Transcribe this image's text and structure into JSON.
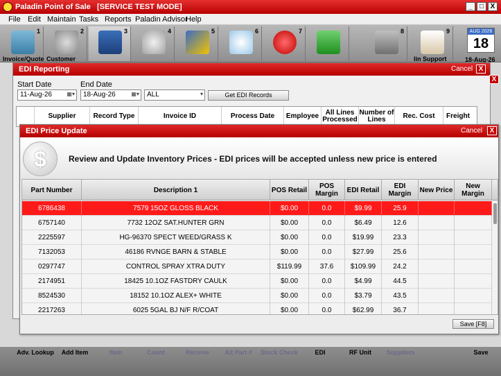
{
  "app": {
    "title": "Paladin Point of Sale",
    "mode": "[SERVICE TEST MODE]",
    "window_buttons": [
      "_",
      "□",
      "X"
    ]
  },
  "menu": [
    "File",
    "Edit",
    "Maintain",
    "Tasks",
    "Reports",
    "Paladin Advisor",
    "Help"
  ],
  "toolbar": {
    "buttons": [
      {
        "num": "1",
        "label": "Invoice/Quote",
        "icon": "calculator-icon"
      },
      {
        "num": "2",
        "label": "Customer",
        "icon": "customer-icon"
      },
      {
        "num": "3",
        "label": "",
        "icon": "inventory-book-icon"
      },
      {
        "num": "4",
        "label": "",
        "icon": "settings-icon"
      },
      {
        "num": "5",
        "label": "",
        "icon": "chart-icon"
      },
      {
        "num": "6",
        "label": "",
        "icon": "disc-icon"
      },
      {
        "num": "7",
        "label": "",
        "icon": "no-entry-icon"
      },
      {
        "num": "",
        "label": "",
        "icon": "money-icon"
      },
      {
        "num": "8",
        "label": "",
        "icon": "home-icon"
      },
      {
        "num": "9",
        "label": "lin Support",
        "icon": "secure-card-icon"
      }
    ],
    "date_tile": {
      "month": "AUG 2026",
      "day": "18",
      "label": "18-Aug-26"
    }
  },
  "edi_reporting": {
    "title": "EDI Reporting",
    "cancel": "Cancel",
    "close": "X",
    "start_date_label": "Start Date",
    "end_date_label": "End Date",
    "start_date": "11-Aug-26",
    "end_date": "18-Aug-26",
    "filter": "ALL",
    "get_button": "Get EDI Records",
    "columns": [
      "Supplier",
      "Record Type",
      "Invoice ID",
      "Process Date",
      "Employee",
      "All Lines Processed",
      "Number of Lines",
      "Rec. Cost",
      "Freight"
    ]
  },
  "price_update": {
    "title": "EDI Price Update",
    "cancel": "Cancel",
    "close": "X",
    "dollar": "$",
    "instructions": "Review and Update Inventory Prices - EDI prices will be accepted unless new price is entered",
    "columns": [
      "Part Number",
      "Description 1",
      "POS Retail",
      "POS Margin",
      "EDI Retail",
      "EDI Margin",
      "New Price",
      "New Margin"
    ],
    "rows": [
      [
        "6786438",
        "7579 15OZ GLOSS BLACK",
        "$0.00",
        "0.0",
        "$9.99",
        "25.9",
        "",
        ""
      ],
      [
        "6757140",
        "7732 12OZ SAT.HUNTER GRN",
        "$0.00",
        "0.0",
        "$6.49",
        "12.6",
        "",
        ""
      ],
      [
        "2225597",
        "HG-96370 SPECT WEED/GRASS K",
        "$0.00",
        "0.0",
        "$19.99",
        "23.3",
        "",
        ""
      ],
      [
        "7132053",
        "46186 RVNGE BARN & STABLE",
        "$0.00",
        "0.0",
        "$27.99",
        "25.6",
        "",
        ""
      ],
      [
        "0297747",
        "CONTROL SPRAY XTRA DUTY",
        "$119.99",
        "37.6",
        "$109.99",
        "24.2",
        "",
        ""
      ],
      [
        "2174951",
        "18425 10.1OZ FASTDRY CAULK",
        "$0.00",
        "0.0",
        "$4.99",
        "44.5",
        "",
        ""
      ],
      [
        "8524530",
        "18152 10.1OZ ALEX+ WHITE",
        "$0.00",
        "0.0",
        "$3.79",
        "43.5",
        "",
        ""
      ],
      [
        "2217263",
        "6025 5GAL BJ N/F R/COAT",
        "$0.00",
        "0.0",
        "$62.99",
        "36.7",
        "",
        ""
      ]
    ],
    "selected_row": 0,
    "save_button": "Save [F8]"
  },
  "bottom_bar": [
    "Adv. Lookup",
    "Add Item",
    "Item",
    "Count",
    "Receive",
    "Alt Part #",
    "Stock Check",
    "EDI",
    "RF Unit",
    "Suppliers",
    "Save"
  ],
  "colors": {
    "accent_red": "#e02020",
    "selected_row": "#ff1a1a"
  }
}
